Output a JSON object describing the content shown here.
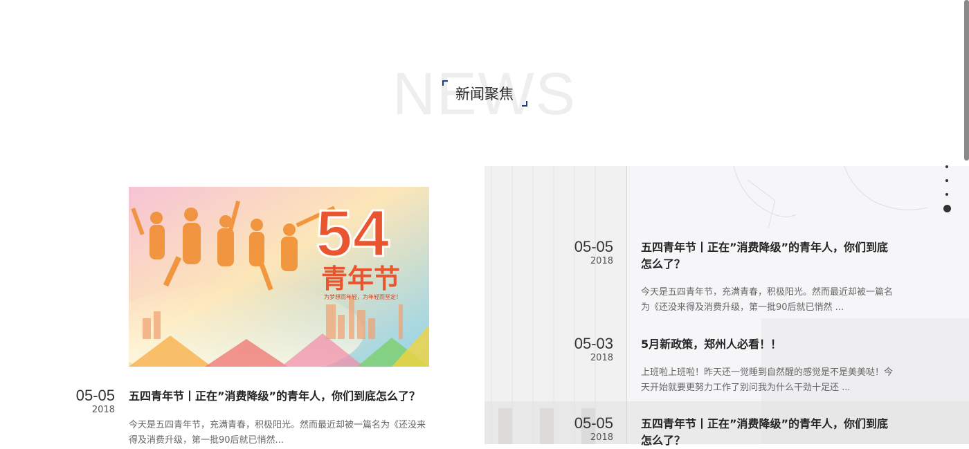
{
  "section": {
    "bg_text": "NEWS",
    "title": "新闻聚焦"
  },
  "featured": {
    "image_text": {
      "number": "54",
      "festival": "青年节",
      "slogan": "为梦想而年轻，为年轻而坚定！"
    },
    "day": "05-05",
    "year": "2018",
    "title": "五四青年节丨正在”消费降级”的青年人，你们到底怎么了？",
    "desc": "今天是五四青年节，充满青春，积极阳光。然而最近却被一篇名为《还没来得及消费升级，第一批90后就已悄然..."
  },
  "news_list": [
    {
      "day": "05-05",
      "year": "2018",
      "title": "五四青年节丨正在”消费降级”的青年人，你们到底怎么了？",
      "desc": "今天是五四青年节，充满青春，积极阳光。然而最近却被一篇名为《还没来得及消费升级，第一批90后就已悄然 ..."
    },
    {
      "day": "05-03",
      "year": "2018",
      "title": "5月新政策，郑州人必看！！",
      "desc": "上班啦上班啦！昨天还一觉睡到自然醒的感觉是不是美美哒！今天开始就要更努力工作了别问我为什么干劲十足还 ..."
    },
    {
      "day": "05-05",
      "year": "2018",
      "title": "五四青年节丨正在”消费降级”的青年人，你们到底怎么了？",
      "desc": ""
    }
  ],
  "pager": {
    "count": 4,
    "active_index": 3
  },
  "colors": {
    "accent": "#1f3c88",
    "panel_bg": "#f6f6f8"
  }
}
